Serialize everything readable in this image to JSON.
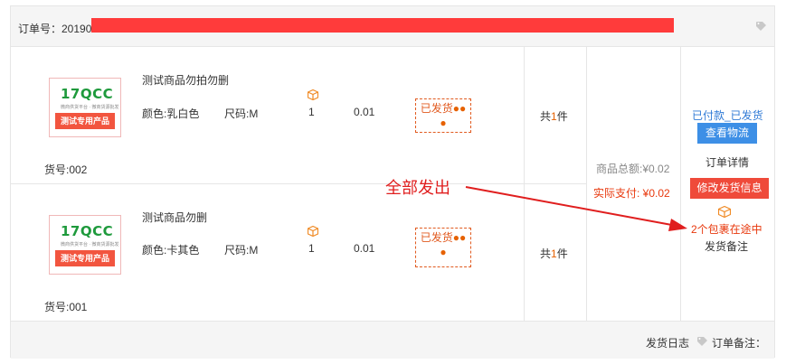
{
  "order": {
    "number_label": "订单号：20190",
    "products": [
      {
        "title": "测试商品勿拍勿删",
        "color": "颜色:乳白色",
        "size": "尺码:M",
        "quantity": "1",
        "price": "0.01",
        "status": "已发货",
        "item_no": "货号:002",
        "count_prefix": "共",
        "count_num": "1",
        "count_suffix": "件",
        "thumb": {
          "logo": "17QCC",
          "tagline": "微商供货平台 · 微商货源批发",
          "band": "测试专用产品"
        }
      },
      {
        "title": "测试商品勿删",
        "color": "颜色:卡其色",
        "size": "尺码:M",
        "quantity": "1",
        "price": "0.01",
        "status": "已发货",
        "item_no": "货号:001",
        "count_prefix": "共",
        "count_num": "1",
        "count_suffix": "件",
        "thumb": {
          "logo": "17QCC",
          "tagline": "微商供货平台 · 微商货源批发",
          "band": "测试专用产品"
        }
      }
    ],
    "goods_total": "商品总额:¥0.02",
    "actual_paid": "实际支付: ¥0.02",
    "pay_status": "已付款_已发货",
    "view_logistics": "查看物流",
    "order_detail": "订单详情",
    "modify_shipping": "修改发货信息",
    "packages_in_transit": "2个包裹在途中",
    "shipping_note": "发货备注"
  },
  "annotation": "全部发出",
  "footer": {
    "shipping_log": "发货日志",
    "order_note": "订单备注："
  },
  "colors": {
    "accent_orange": "#e66100",
    "blue": "#2f7ad6",
    "button_blue": "#3d8fe6",
    "button_red": "#ef4a3a",
    "redaction": "#ff3b3b"
  }
}
